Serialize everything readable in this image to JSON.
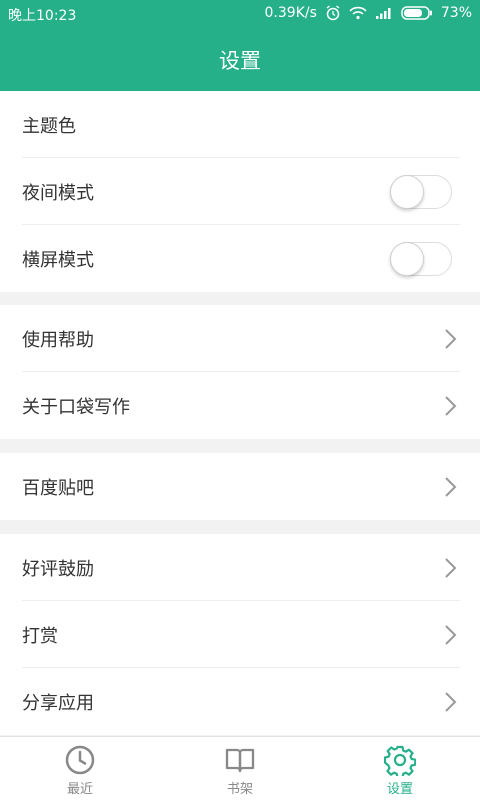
{
  "status_bar": {
    "time": "晚上10:23",
    "speed": "0.39K/s",
    "battery": "73%",
    "icons": [
      "alarm-icon",
      "wifi-icon",
      "signal-icon",
      "battery-icon"
    ]
  },
  "app_bar": {
    "title": "设置"
  },
  "groups": [
    {
      "items": [
        {
          "label": "主题色"
        },
        {
          "label": "夜间模式",
          "toggle_on": false
        },
        {
          "label": "横屏模式",
          "toggle_on": false
        }
      ]
    },
    {
      "items": [
        {
          "label": "使用帮助"
        },
        {
          "label": "关于口袋写作"
        }
      ]
    },
    {
      "items": [
        {
          "label": "百度贴吧"
        }
      ]
    },
    {
      "items": [
        {
          "label": "好评鼓励"
        },
        {
          "label": "打赏"
        },
        {
          "label": "分享应用"
        }
      ]
    }
  ],
  "tabs": [
    {
      "label": "最近",
      "icon": "clock-icon",
      "active": false
    },
    {
      "label": "书架",
      "icon": "book-icon",
      "active": false
    },
    {
      "label": "设置",
      "icon": "gear-icon",
      "active": true
    }
  ],
  "colors": {
    "accent": "#26b08a",
    "background": "#f2f2f2",
    "text": "#333333",
    "inactive_tab": "#888888"
  }
}
